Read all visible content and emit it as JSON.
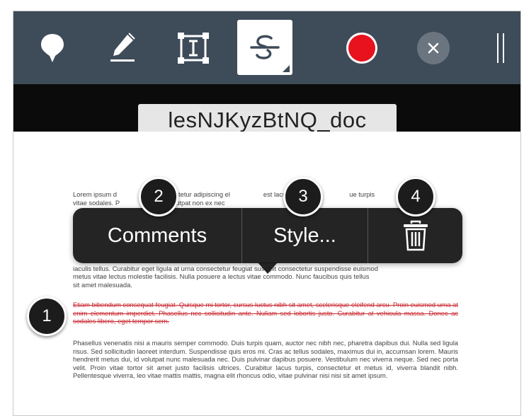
{
  "toolbar": {
    "icons": [
      "pin-icon",
      "pen-icon",
      "text-box-icon",
      "strikethrough-icon",
      "record-icon",
      "close-icon",
      "sidebar-toggle-icon"
    ],
    "selected_tool": "strikethrough-icon",
    "record_color": "#e8111e",
    "background_color": "#3e4b59"
  },
  "document": {
    "title": "lesNJKyzBtNQ_doc",
    "paragraph_1_line_1": "Lorem ipsum d                   t, consectetur adipiscing el                  est lacus. Donec                    ue turpis",
    "paragraph_1_line_2": "vitae sodales. P                   est, volutpat non ex nec",
    "paragraph_1_hidden_1": "iaculis tellus. Curabitur eget ligula at urna consectetur feugiat suscipit consectetur suspendisse euismod",
    "paragraph_1_line_3": "metus vitae lectus molestie facilisis. Nulla posuere a lectus vitae commodo. Nunc faucibus quis tellus",
    "paragraph_1_line_4": "sit amet malesuada.",
    "strikethrough_paragraph": "Etiam bibendum consequat feugiat. Quisque mi tortor, cursus luctus nibh sit amet, scelerisque eleifend arcu. Proin euismod urna at enim elementum imperdiet. Phasellus nec sollicitudin ante. Nullam sed lobortis justo. Curabitur at vehicula massa. Donec ac sodales libero, eget tempor sem.",
    "paragraph_3": "Phasellus venenatis nisi a mauris semper commodo. Duis turpis quam, auctor nec nibh nec, pharetra dapibus dui. Nulla sed ligula risus. Sed sollicitudin laoreet interdum. Suspendisse quis eros mi. Cras ac tellus sodales, maximus dui in, accumsan lorem. Mauris hendrerit metus dui, id volutpat nunc malesuada nec. Duis pulvinar dapibus posuere. Vestibulum nec viverra neque. Sed nec porta velit. Proin vitae tortor sit amet justo facilisis ultrices. Curabitur lacus turpis, consectetur et metus id, viverra blandit nibh. Pellentesque viverra, leo vitae mattis mattis, magna elit rhoncus odio, vitae pulvinar nisi nisi sit amet ipsum.",
    "strike_color": "#c8232c"
  },
  "context_menu": {
    "comments_label": "Comments",
    "style_label": "Style...",
    "delete_icon": "trash-icon"
  },
  "callouts": {
    "badge_1": "1",
    "badge_2": "2",
    "badge_3": "3",
    "badge_4": "4"
  }
}
